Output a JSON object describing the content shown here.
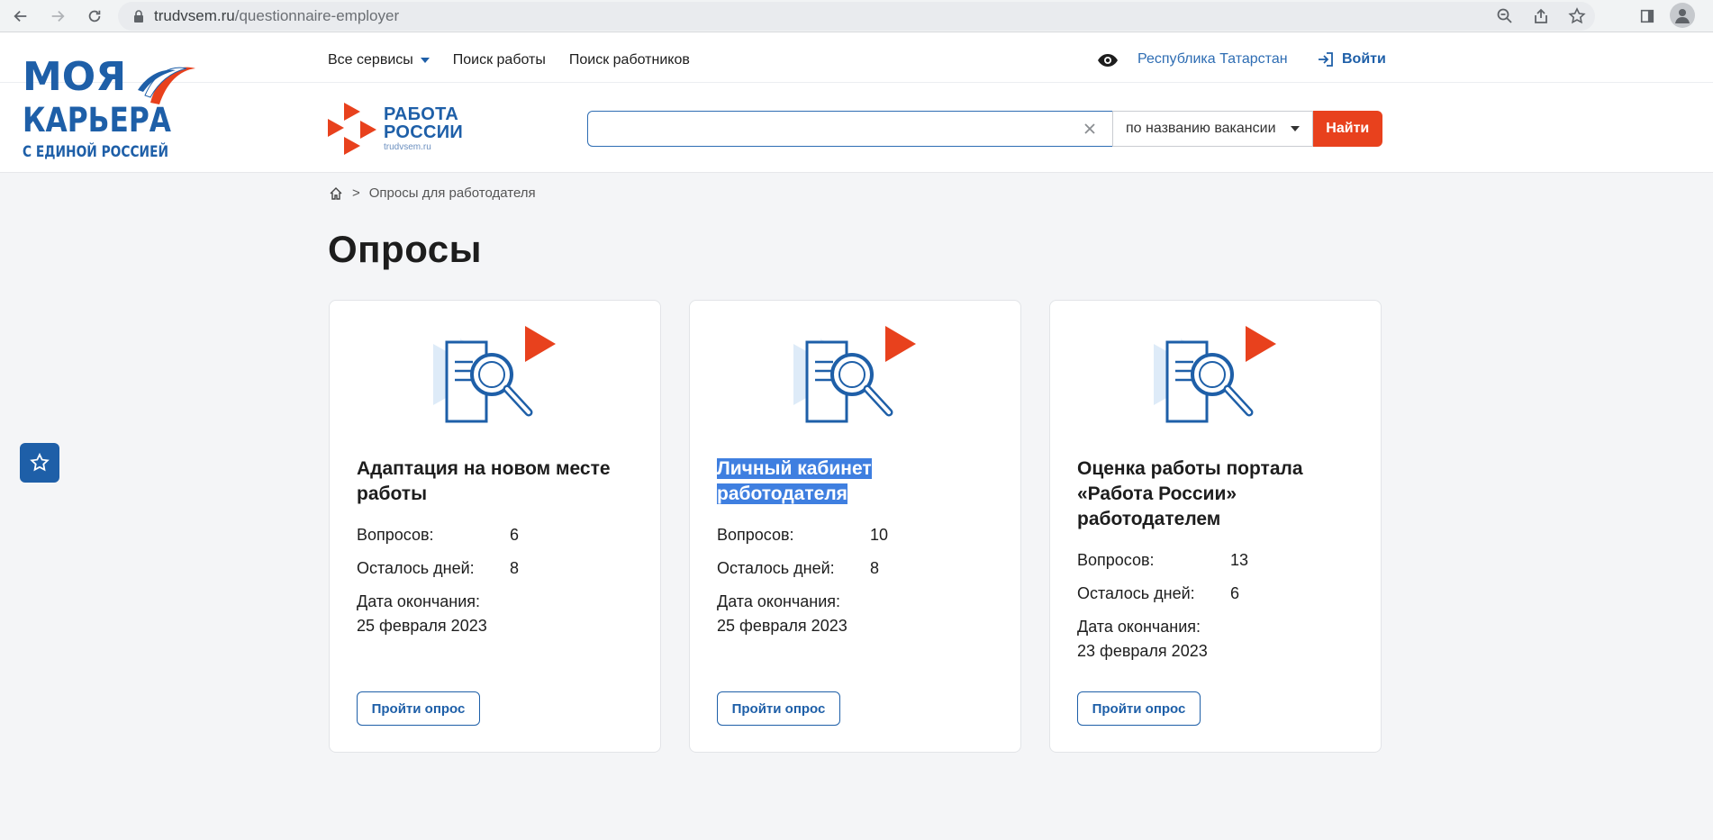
{
  "browser": {
    "url_host": "trudvsem.ru",
    "url_path": "/questionnaire-employer"
  },
  "header": {
    "moya_logo_lines": [
      "МОЯ",
      "КАРЬЕРА",
      "С ЕДИНОЙ РОССИЕЙ"
    ],
    "nav": {
      "services": "Все сервисы",
      "job_search": "Поиск работы",
      "worker_search": "Поиск работников"
    },
    "region": "Республика Татарстан",
    "login": "Войти",
    "rr_logo": {
      "line1": "РАБОТА",
      "line2": "РОССИИ",
      "line3": "trudvsem.ru"
    },
    "search": {
      "value": "",
      "mode": "по названию вакансии",
      "button": "Найти"
    }
  },
  "breadcrumb": {
    "separator": ">",
    "current": "Опросы для работодателя"
  },
  "page_title": "Опросы",
  "labels": {
    "questions": "Вопросов:",
    "days_left": "Осталось дней:",
    "end_date": "Дата окончания:",
    "take_survey": "Пройти опрос"
  },
  "cards": [
    {
      "title": "Адаптация на новом месте работы",
      "questions": "6",
      "days_left": "8",
      "end_date": "25 февраля 2023"
    },
    {
      "title": "Личный кабинет работодателя",
      "title_lines": [
        "Личный кабинет",
        "работодателя"
      ],
      "questions": "10",
      "days_left": "8",
      "end_date": "25 февраля 2023",
      "selected": true
    },
    {
      "title": "Оценка работы портала «Работа России» работодателем",
      "questions": "13",
      "days_left": "6",
      "end_date": "23 февраля 2023"
    }
  ],
  "colors": {
    "brand_blue": "#1e5fa8",
    "accent_red": "#e8411d",
    "selection": "#3f7fe0"
  }
}
